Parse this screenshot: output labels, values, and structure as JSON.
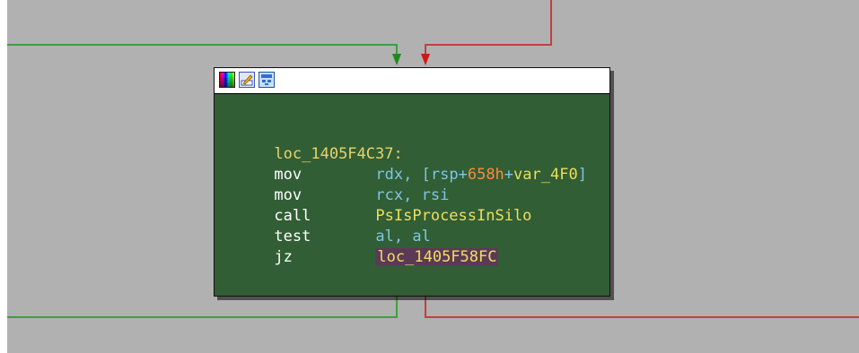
{
  "colors": {
    "canvas_bg": "#b1b1b1",
    "node_bg": "#315e35",
    "edge_true": "#3f9e41",
    "edge_false": "#c53f3f"
  },
  "node": {
    "header_icons": [
      "color-palette-icon",
      "rename-pencil-icon",
      "graph-view-icon"
    ],
    "label": "loc_1405F4C37:",
    "instructions": [
      {
        "mnemonic": "mov",
        "op1": "rdx",
        "sep": ", ",
        "bracket_open": "[",
        "base": "rsp",
        "plus1": "+",
        "num": "658h",
        "plus2": "+",
        "var": "var_4F0",
        "bracket_close": "]"
      },
      {
        "mnemonic": "mov",
        "operands": "rcx, rsi"
      },
      {
        "mnemonic": "call",
        "target": "PsIsProcessInSilo"
      },
      {
        "mnemonic": "test",
        "operands": "al, al"
      },
      {
        "mnemonic": "jz",
        "target": "loc_1405F58FC"
      }
    ]
  }
}
